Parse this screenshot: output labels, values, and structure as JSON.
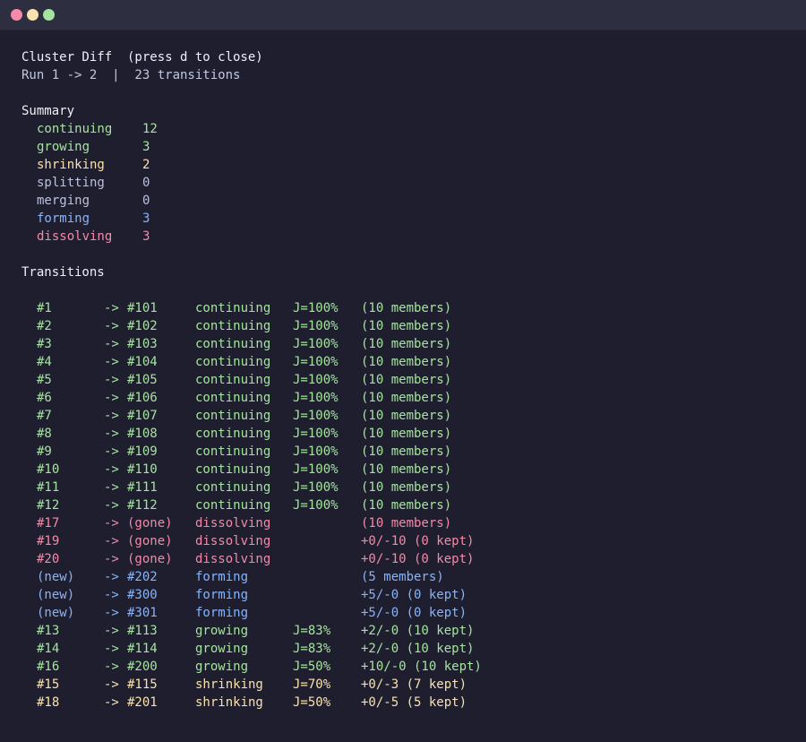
{
  "window": {
    "title": ""
  },
  "header": {
    "title": "Cluster Diff  (press d to close)",
    "subtitle": "Run 1 -> 2  |  23 transitions"
  },
  "summary": {
    "heading": "Summary",
    "items": [
      {
        "label": "continuing",
        "count": "12",
        "color": "green"
      },
      {
        "label": "growing",
        "count": "3",
        "color": "green"
      },
      {
        "label": "shrinking",
        "count": "2",
        "color": "yellow"
      },
      {
        "label": "splitting",
        "count": "0",
        "color": "gray"
      },
      {
        "label": "merging",
        "count": "0",
        "color": "gray"
      },
      {
        "label": "forming",
        "count": "3",
        "color": "blue"
      },
      {
        "label": "dissolving",
        "count": "3",
        "color": "pink"
      }
    ]
  },
  "transitions": {
    "heading": "Transitions",
    "rows": [
      {
        "from": "#1",
        "arrow": "->",
        "to": "#101",
        "kind": "continuing",
        "jaccard": "J=100%",
        "detail": "(10 members)",
        "color": "green"
      },
      {
        "from": "#2",
        "arrow": "->",
        "to": "#102",
        "kind": "continuing",
        "jaccard": "J=100%",
        "detail": "(10 members)",
        "color": "green"
      },
      {
        "from": "#3",
        "arrow": "->",
        "to": "#103",
        "kind": "continuing",
        "jaccard": "J=100%",
        "detail": "(10 members)",
        "color": "green"
      },
      {
        "from": "#4",
        "arrow": "->",
        "to": "#104",
        "kind": "continuing",
        "jaccard": "J=100%",
        "detail": "(10 members)",
        "color": "green"
      },
      {
        "from": "#5",
        "arrow": "->",
        "to": "#105",
        "kind": "continuing",
        "jaccard": "J=100%",
        "detail": "(10 members)",
        "color": "green"
      },
      {
        "from": "#6",
        "arrow": "->",
        "to": "#106",
        "kind": "continuing",
        "jaccard": "J=100%",
        "detail": "(10 members)",
        "color": "green"
      },
      {
        "from": "#7",
        "arrow": "->",
        "to": "#107",
        "kind": "continuing",
        "jaccard": "J=100%",
        "detail": "(10 members)",
        "color": "green"
      },
      {
        "from": "#8",
        "arrow": "->",
        "to": "#108",
        "kind": "continuing",
        "jaccard": "J=100%",
        "detail": "(10 members)",
        "color": "green"
      },
      {
        "from": "#9",
        "arrow": "->",
        "to": "#109",
        "kind": "continuing",
        "jaccard": "J=100%",
        "detail": "(10 members)",
        "color": "green"
      },
      {
        "from": "#10",
        "arrow": "->",
        "to": "#110",
        "kind": "continuing",
        "jaccard": "J=100%",
        "detail": "(10 members)",
        "color": "green"
      },
      {
        "from": "#11",
        "arrow": "->",
        "to": "#111",
        "kind": "continuing",
        "jaccard": "J=100%",
        "detail": "(10 members)",
        "color": "green"
      },
      {
        "from": "#12",
        "arrow": "->",
        "to": "#112",
        "kind": "continuing",
        "jaccard": "J=100%",
        "detail": "(10 members)",
        "color": "green"
      },
      {
        "from": "#17",
        "arrow": "->",
        "to": "(gone)",
        "kind": "dissolving",
        "jaccard": "",
        "detail": "(10 members)",
        "color": "pink"
      },
      {
        "from": "#19",
        "arrow": "->",
        "to": "(gone)",
        "kind": "dissolving",
        "jaccard": "",
        "detail": "+0/-10 (0 kept)",
        "color": "pink"
      },
      {
        "from": "#20",
        "arrow": "->",
        "to": "(gone)",
        "kind": "dissolving",
        "jaccard": "",
        "detail": "+0/-10 (0 kept)",
        "color": "pink"
      },
      {
        "from": "(new)",
        "arrow": "->",
        "to": "#202",
        "kind": "forming",
        "jaccard": "",
        "detail": "(5 members)",
        "color": "blue"
      },
      {
        "from": "(new)",
        "arrow": "->",
        "to": "#300",
        "kind": "forming",
        "jaccard": "",
        "detail": "+5/-0 (0 kept)",
        "color": "blue"
      },
      {
        "from": "(new)",
        "arrow": "->",
        "to": "#301",
        "kind": "forming",
        "jaccard": "",
        "detail": "+5/-0 (0 kept)",
        "color": "blue"
      },
      {
        "from": "#13",
        "arrow": "->",
        "to": "#113",
        "kind": "growing",
        "jaccard": "J=83%",
        "detail": "+2/-0 (10 kept)",
        "color": "green"
      },
      {
        "from": "#14",
        "arrow": "->",
        "to": "#114",
        "kind": "growing",
        "jaccard": "J=83%",
        "detail": "+2/-0 (10 kept)",
        "color": "green"
      },
      {
        "from": "#16",
        "arrow": "->",
        "to": "#200",
        "kind": "growing",
        "jaccard": "J=50%",
        "detail": "+10/-0 (10 kept)",
        "color": "green"
      },
      {
        "from": "#15",
        "arrow": "->",
        "to": "#115",
        "kind": "shrinking",
        "jaccard": "J=70%",
        "detail": "+0/-3 (7 kept)",
        "color": "yellow"
      },
      {
        "from": "#18",
        "arrow": "->",
        "to": "#201",
        "kind": "shrinking",
        "jaccard": "J=50%",
        "detail": "+0/-5 (5 kept)",
        "color": "yellow"
      }
    ]
  }
}
